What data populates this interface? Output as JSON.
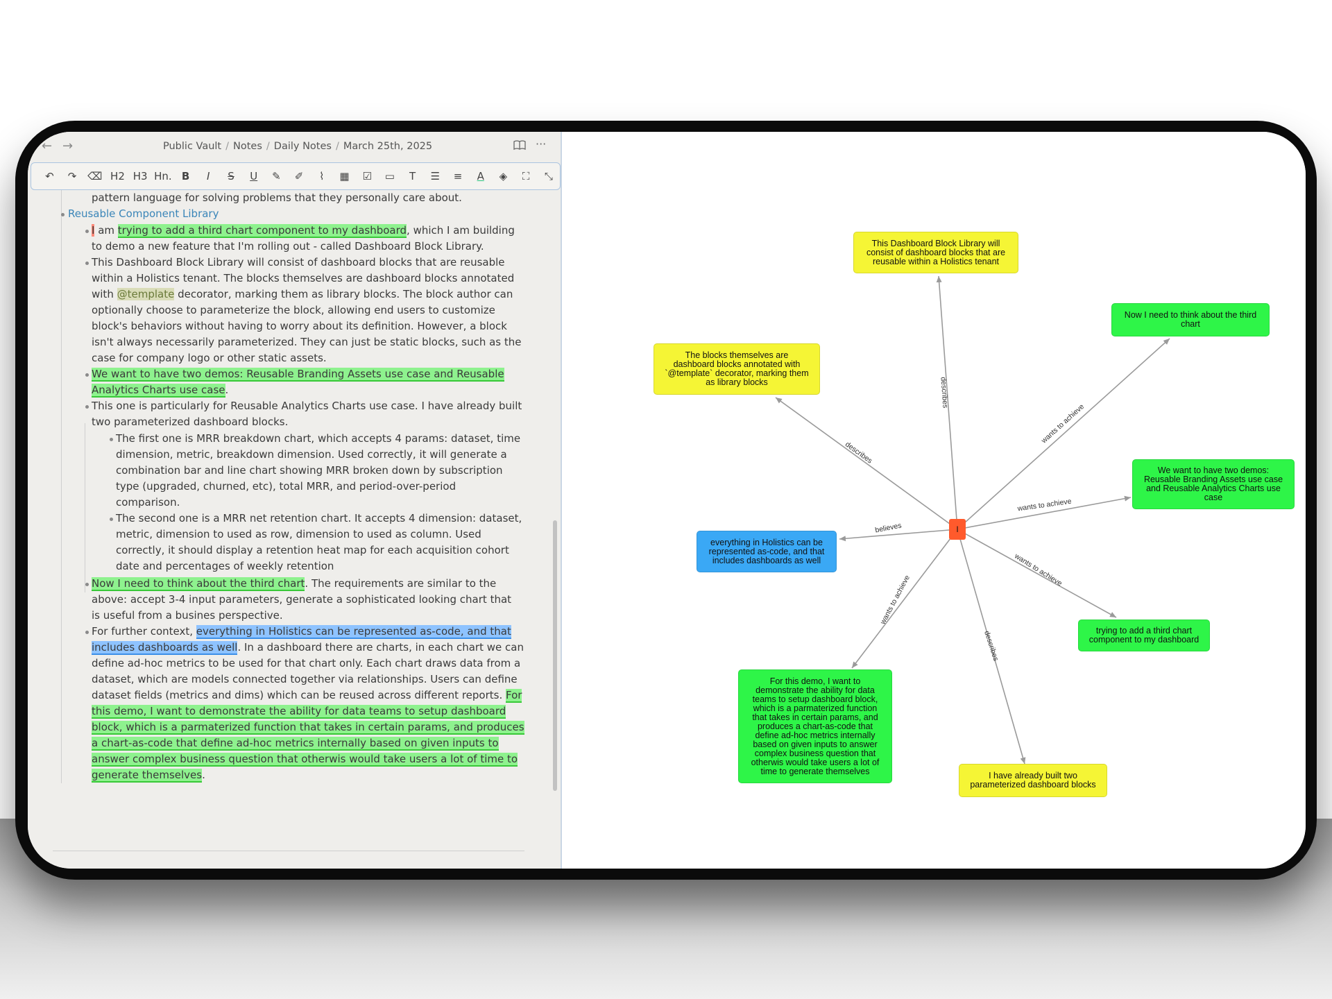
{
  "titlebar": {
    "back_icon": "arrow-left-icon",
    "forward_icon": "arrow-right-icon",
    "breadcrumb": [
      "Public Vault",
      "Notes",
      "Daily Notes",
      "March 25th, 2025"
    ],
    "reading_icon": "book-open-icon",
    "more_icon": "more-horizontal-icon"
  },
  "toolbar": {
    "tools": [
      {
        "name": "undo",
        "glyph": "↶"
      },
      {
        "name": "redo",
        "glyph": "↷"
      },
      {
        "name": "eraser",
        "glyph": "⌫"
      },
      {
        "name": "heading-2",
        "glyph": "H2"
      },
      {
        "name": "heading-3",
        "glyph": "H3"
      },
      {
        "name": "heading-n",
        "glyph": "Hn."
      },
      {
        "name": "bold",
        "glyph": "B"
      },
      {
        "name": "italic",
        "glyph": "I"
      },
      {
        "name": "strikethrough",
        "glyph": "S"
      },
      {
        "name": "underline",
        "glyph": "U"
      },
      {
        "name": "highlight-pen",
        "glyph": "✎"
      },
      {
        "name": "edit",
        "glyph": "✐"
      },
      {
        "name": "attachment",
        "glyph": "⌇"
      },
      {
        "name": "table",
        "glyph": "▦"
      },
      {
        "name": "checkbox",
        "glyph": "☑"
      },
      {
        "name": "callout",
        "glyph": "▭"
      },
      {
        "name": "text-size",
        "glyph": "T"
      },
      {
        "name": "list",
        "glyph": "☰"
      },
      {
        "name": "align",
        "glyph": "≡"
      },
      {
        "name": "text-color",
        "glyph": "A"
      },
      {
        "name": "fill-color",
        "glyph": "◈"
      },
      {
        "name": "fullscreen",
        "glyph": "⛶"
      },
      {
        "name": "collapse",
        "glyph": "⤡"
      }
    ]
  },
  "doc": {
    "intro_tail": "pattern language for solving problems that they personally care about.",
    "section_title": "Reusable Component Library",
    "p1": {
      "hl_i": "I",
      "am": " am ",
      "hl": "trying to add a third chart component to my dashboard",
      "rest1": ", which I am building",
      "line2": "to demo a new feature that I'm rolling out - called Dashboard Block Library."
    },
    "p2": {
      "l1": "This Dashboard Block Library will consist of dashboard blocks that are reusable",
      "l2": "within a Holistics tenant. The blocks themselves are dashboard blocks annotated",
      "l3a": "with ",
      "tag": "@template",
      "l3b": " decorator, marking them as library blocks. The block author can",
      "l4": "optionally choose to parameterize the block, allowing end users to customize",
      "l5": "block's behaviors without having to worry about its definition. However, a block",
      "l6": "isn't always necessarily parameterized. They can just be static blocks, such as the",
      "l7": "case for company logo or other static assets."
    },
    "p3": {
      "l1": "We want to have two demos: Reusable Branding Assets use case and Reusable",
      "l2": "Analytics Charts use case",
      "l2_end": "."
    },
    "p4": {
      "l1": "This one is particularly for Reusable Analytics Charts use case. I have already built",
      "l2": "two parameterized dashboard blocks."
    },
    "p4a": {
      "l1": "The first one is MRR breakdown chart, which accepts 4 params: dataset, time",
      "l2": "dimension, metric, breakdown dimension. Used correctly, it will generate a",
      "l3": "combination bar and line chart showing MRR broken down by subscription",
      "l4": "type (upgraded, churned, etc), total MRR, and period-over-period",
      "l5": "comparison."
    },
    "p4b": {
      "l1": "The second one is a MRR net retention chart. It accepts 4 dimension: dataset,",
      "l2": "metric, dimension to used as row, dimension to used as column. Used",
      "l3": "correctly, it should display a retention heat map for each acquisition cohort",
      "l4": "date and percentages of weekly retention"
    },
    "p5": {
      "hl": "Now I need to think about the third chart",
      "rest1": ". The requirements are similar to the",
      "l2": "above: accept 3-4 input parameters, generate a sophisticated looking chart that",
      "l3": "is useful from a busines perspective."
    },
    "p6": {
      "l1a": "For further context, ",
      "hl_b1": "everything in Holistics can be represented as-code, and that",
      "hl_b2": "includes dashboards as well",
      "l2b": ". In a dashboard there are charts, in each chart we can",
      "l3": "define ad-hoc metrics to be used for that chart only. Each chart draws data from a",
      "l4": "dataset, which are models connected together via relationships. Users can define",
      "l5a": "dataset fields (metrics and dims) which can be reused across different reports. ",
      "l5hl": "For",
      "g1": "this demo, I want to demonstrate the ability for data teams to setup dashboard",
      "g2": "block, which is a parmaterized function that takes in certain params, and produces",
      "g3": "a chart-as-code that define ad-hoc metrics internally based on given inputs to",
      "g4": "answer complex business question that otherwis would take users a lot of time to",
      "g5": "generate themselves",
      "end": "."
    }
  },
  "graph": {
    "center_label": "I",
    "nodes": [
      {
        "id": "library",
        "color": "yellow",
        "text": "This Dashboard Block Library will\nconsist of dashboard blocks that are\nreusable within a Holistics tenant"
      },
      {
        "id": "third-chart-think",
        "color": "green",
        "text": "Now I need to think about the third\nchart"
      },
      {
        "id": "blocks-annotated",
        "color": "yellow",
        "text": "The blocks themselves are\ndashboard blocks annotated with\n`@template` decorator, marking them\nas library blocks"
      },
      {
        "id": "two-demos",
        "color": "green",
        "text": "We want to have two demos:\nReusable Branding Assets use case\nand Reusable Analytics Charts use\ncase"
      },
      {
        "id": "as-code",
        "color": "blue",
        "text": "everything in Holistics can be\nrepresented as-code, and that\nincludes dashboards as well"
      },
      {
        "id": "add-third-chart",
        "color": "green",
        "text": "trying to add a third chart\ncomponent to my dashboard"
      },
      {
        "id": "demo-ability",
        "color": "green",
        "text": "For this demo, I want to\ndemonstrate the ability for data\nteams to setup dashboard block,\nwhich is a parmaterized function\nthat takes in certain params, and\nproduces a chart-as-code that\ndefine ad-hoc metrics internally\nbased on given inputs to answer\ncomplex business question that\notherwis would take users a lot of\ntime to generate themselves"
      },
      {
        "id": "two-built",
        "color": "yellow",
        "text": "I have already built two\nparameterized dashboard blocks"
      }
    ],
    "edges": [
      {
        "to": "library",
        "label": "describes"
      },
      {
        "to": "third-chart-think",
        "label": "wants to achieve"
      },
      {
        "to": "blocks-annotated",
        "label": "describes"
      },
      {
        "to": "two-demos",
        "label": "wants to achieve"
      },
      {
        "to": "as-code",
        "label": "believes"
      },
      {
        "to": "add-third-chart",
        "label": "wants to achieve"
      },
      {
        "to": "demo-ability",
        "label": "wants to achieve"
      },
      {
        "to": "two-built",
        "label": "describes"
      }
    ],
    "colors": {
      "yellow": "#f5f535",
      "green": "#2ef548",
      "blue": "#3aa8f5",
      "center": "#ff5a2c",
      "edge": "#9a9a9a"
    }
  }
}
